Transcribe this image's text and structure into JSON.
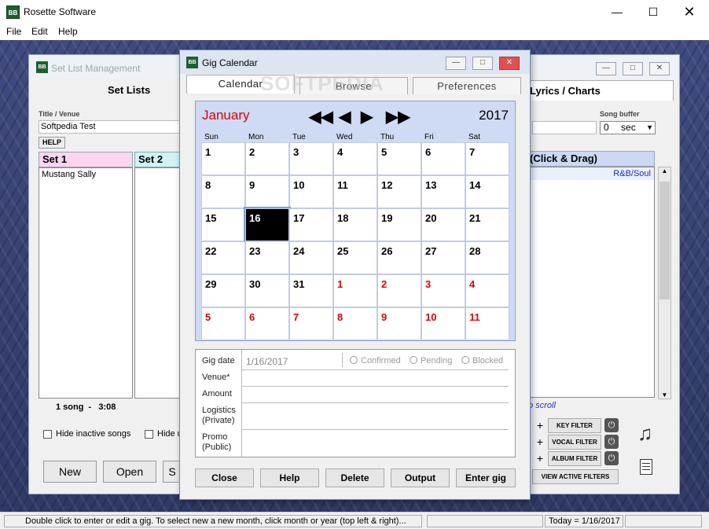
{
  "app": {
    "title": "Rosette Software",
    "icon_text": "BB"
  },
  "menu": [
    "File",
    "Edit",
    "Help"
  ],
  "setlist_window": {
    "title": "Set List Management",
    "set_lists_label": "Set Lists",
    "title_venue_label": "Title / Venue",
    "title_venue_value": "Softpedia Test",
    "help_label": "HELP",
    "columns": [
      "Set 1",
      "Set 2"
    ],
    "set1_items": [
      "Mustang Sally"
    ],
    "song_count": "1 song  -   3:08",
    "hide_inactive": "Hide inactive songs",
    "hide_other": "Hide u",
    "buttons": [
      "New",
      "Open",
      "S"
    ],
    "lyrics_tab": "Lyrics / Charts",
    "song_buffer_label": "Song buffer",
    "song_buffer_value": "0",
    "song_buffer_unit": "sec",
    "click_drag": "(Click & Drag)",
    "genre_item": "R&B/Soul",
    "scroll_hint": "to scroll",
    "filters": [
      "KEY FILTER",
      "VOCAL FILTER",
      "ALBUM FILTER"
    ],
    "view_filters": "VIEW ACTIVE FILTERS"
  },
  "gig_calendar": {
    "title": "Gig Calendar",
    "tabs": [
      "Calendar",
      "Browse",
      "Preferences"
    ],
    "month": "January",
    "year": "2017",
    "nav": [
      "◀◀",
      "◀",
      "▶",
      "▶▶"
    ],
    "weekdays": [
      "Sun",
      "Mon",
      "Tue",
      "Wed",
      "Thu",
      "Fri",
      "Sat"
    ],
    "days": [
      [
        "1",
        "2",
        "3",
        "4",
        "5",
        "6",
        "7"
      ],
      [
        "8",
        "9",
        "10",
        "11",
        "12",
        "13",
        "14"
      ],
      [
        "15",
        "16",
        "17",
        "18",
        "19",
        "20",
        "21"
      ],
      [
        "22",
        "23",
        "24",
        "25",
        "26",
        "27",
        "28"
      ],
      [
        "29",
        "30",
        "31",
        "1",
        "2",
        "3",
        "4"
      ],
      [
        "5",
        "6",
        "7",
        "8",
        "9",
        "10",
        "11"
      ]
    ],
    "selected_day": "16",
    "other_month_color": "#e00000",
    "details": {
      "gig_date_label": "Gig date",
      "gig_date_value": "1/16/2017",
      "status_options": [
        "Confirmed",
        "Pending",
        "Blocked"
      ],
      "venue_label": "Venue*",
      "amount_label": "Amount",
      "logistics_label": "Logistics\n(Private)",
      "promo_label": "Promo\n(Public)"
    },
    "buttons": [
      "Close",
      "Help",
      "Delete",
      "Output",
      "Enter gig"
    ]
  },
  "status": {
    "hint": "Double click to enter or edit a gig.  To select new a new month, click month or year (top left & right)...",
    "today": "Today = 1/16/2017"
  },
  "watermark": "SOFTPEDIA"
}
